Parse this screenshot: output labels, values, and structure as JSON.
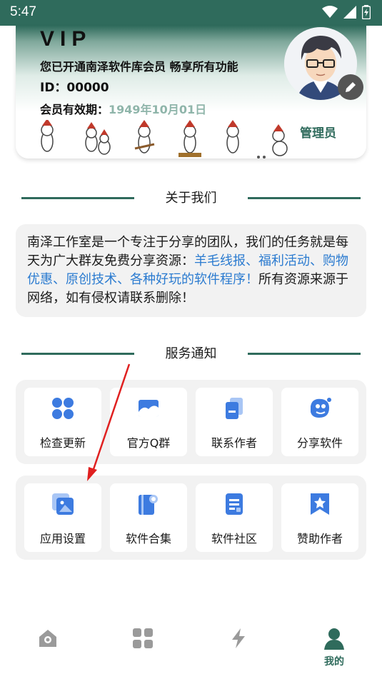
{
  "status_bar": {
    "time": "5:47",
    "icons": [
      "wifi-icon",
      "signal-icon",
      "battery-icon"
    ]
  },
  "vip_card": {
    "title": "VIP",
    "description": "您已开通南泽软件库会员 畅享所有功能",
    "id_text": "ID：00000",
    "expire_label": "会员有效期：",
    "expire_date": "1949年10月01日",
    "admin_label": "管理员",
    "avatar_icon": "avatar",
    "edit_icon": "pencil-icon"
  },
  "about": {
    "heading": "关于我们",
    "text_before": "南泽工作室是一个专注于分享的团队，我们的任务就是每天为广大群友免费分享资源：",
    "text_link": "羊毛线报、福利活动、购物优惠、原创技术、各种好玩的软件程序！",
    "text_after": "所有资源来源于网络，如有侵权请联系删除！"
  },
  "services": {
    "heading": "服务通知",
    "row1": [
      {
        "label": "检查更新",
        "icon": "clover-icon"
      },
      {
        "label": "官方Q群",
        "icon": "image-card-icon"
      },
      {
        "label": "联系作者",
        "icon": "document-copy-icon"
      },
      {
        "label": "分享软件",
        "icon": "share-mascot-icon"
      }
    ],
    "row2": [
      {
        "label": "应用设置",
        "icon": "gallery-icon"
      },
      {
        "label": "软件合集",
        "icon": "folder-search-icon"
      },
      {
        "label": "软件社区",
        "icon": "document-icon"
      },
      {
        "label": "赞助作者",
        "icon": "star-bookmark-icon"
      }
    ]
  },
  "bottom_nav": {
    "items": [
      {
        "label": "",
        "icon": "home-icon"
      },
      {
        "label": "",
        "icon": "apps-icon"
      },
      {
        "label": "",
        "icon": "lightning-icon"
      },
      {
        "label": "我的",
        "icon": "person-icon"
      }
    ]
  },
  "colors": {
    "primary": "#2f6b5c",
    "link": "#2b7bd0",
    "icon_blue": "#3d7be0",
    "panel": "#f2f2f2"
  }
}
